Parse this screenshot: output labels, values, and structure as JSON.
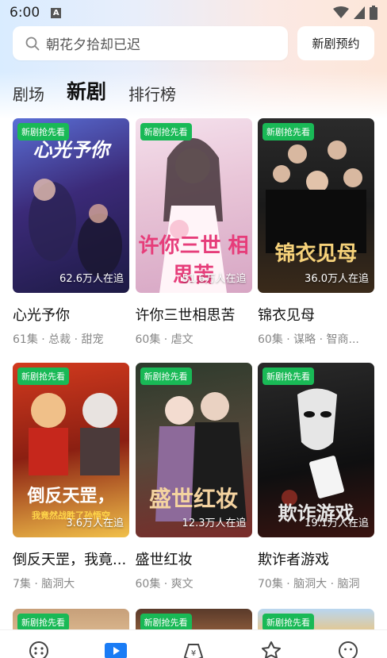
{
  "status_bar": {
    "time": "6:00",
    "a_icon": "A"
  },
  "search": {
    "placeholder": "朝花夕拾却已迟"
  },
  "reserve_button": "新剧预约",
  "tabs": [
    {
      "label": "剧场",
      "active": false
    },
    {
      "label": "新剧",
      "active": true
    },
    {
      "label": "排行榜",
      "active": false
    }
  ],
  "cards": [
    {
      "badge": "新剧抢先看",
      "viewers": "62.6万人在追",
      "poster_text": "心光予你",
      "title": "心光予你",
      "meta": "61集 · 总裁 · 甜宠"
    },
    {
      "badge": "新剧抢先看",
      "viewers": "51.6万人在追",
      "poster_text": "许你三世 相思苦",
      "title": "许你三世相思苦",
      "meta": "60集 · 虐文"
    },
    {
      "badge": "新剧抢先看",
      "viewers": "36.0万人在追",
      "poster_text": "锦衣见母",
      "title": "锦衣见母",
      "meta": "60集 · 谋略 · 智商..."
    },
    {
      "badge": "新剧抢先看",
      "viewers": "3.6万人在追",
      "poster_text": "倒反天罡，",
      "poster_sub": "我竟然战胜了孙悟空",
      "title": "倒反天罡，我竟...",
      "meta": "7集 · 脑洞大"
    },
    {
      "badge": "新剧抢先看",
      "viewers": "12.3万人在追",
      "poster_text": "盛世红妆",
      "title": "盛世红妆",
      "meta": "60集 · 爽文"
    },
    {
      "badge": "新剧抢先看",
      "viewers": "19.1万人在追",
      "poster_text": "欺诈游戏",
      "title": "欺诈者游戏",
      "meta": "70集 · 脑洞大 · 脑洞"
    }
  ],
  "partial_cards": [
    {
      "badge": "新剧抢先看"
    },
    {
      "badge": "新剧抢先看"
    },
    {
      "badge": "新剧抢先看"
    }
  ],
  "bottom_nav": [
    {
      "icon": "theater-icon"
    },
    {
      "icon": "play-icon",
      "active": true
    },
    {
      "icon": "coin-bag-icon"
    },
    {
      "icon": "star-icon"
    },
    {
      "icon": "profile-icon"
    }
  ],
  "colors": {
    "badge": "#19b956",
    "nav_active": "#1a7cf5"
  }
}
